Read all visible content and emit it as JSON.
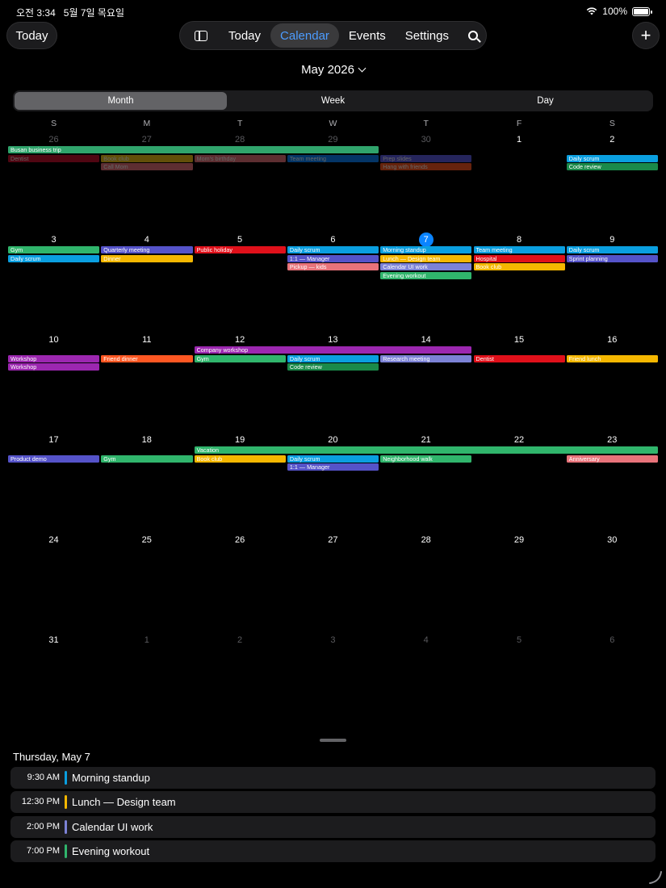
{
  "status_bar": {
    "time": "오전 3:34",
    "date": "5월 7일 목요일",
    "battery": "100%"
  },
  "toolbar": {
    "today_button": "Today",
    "nav": [
      "Today",
      "Calendar",
      "Events",
      "Settings"
    ],
    "active_nav": "Calendar"
  },
  "month_title": "May 2026",
  "view_segments": [
    "Month",
    "Week",
    "Day"
  ],
  "active_segment": "Month",
  "weekday_headers": [
    "S",
    "M",
    "T",
    "W",
    "T",
    "F",
    "S"
  ],
  "weeks": [
    {
      "days": [
        {
          "n": "26",
          "dim": true
        },
        {
          "n": "27",
          "dim": true
        },
        {
          "n": "28",
          "dim": true
        },
        {
          "n": "29",
          "dim": true
        },
        {
          "n": "30",
          "dim": true
        },
        {
          "n": "1"
        },
        {
          "n": "2"
        }
      ],
      "events": [
        {
          "title": "Busan business trip",
          "start": 0,
          "span": 4,
          "lane": 0,
          "color": "#30a46c"
        },
        {
          "title": "Dentist",
          "start": 0,
          "span": 1,
          "lane": 1,
          "color": "#c8102e",
          "dim": true
        },
        {
          "title": "Book club",
          "start": 1,
          "span": 1,
          "lane": 1,
          "color": "#f5c518",
          "dim": true
        },
        {
          "title": "Call Mom",
          "start": 1,
          "span": 1,
          "lane": 2,
          "color": "#e8737a",
          "dim": true
        },
        {
          "title": "Mom's birthday",
          "start": 2,
          "span": 1,
          "lane": 1,
          "color": "#e8737a",
          "dim": true
        },
        {
          "title": "Team meeting",
          "start": 3,
          "span": 1,
          "lane": 1,
          "color": "#0a84ff",
          "dim": true
        },
        {
          "title": "Prep slides",
          "start": 4,
          "span": 1,
          "lane": 1,
          "color": "#5e5ce6",
          "dim": true
        },
        {
          "title": "Hang with friends",
          "start": 4,
          "span": 1,
          "lane": 2,
          "color": "#ff5722",
          "dim": true
        },
        {
          "title": "Daily scrum",
          "start": 6,
          "span": 1,
          "lane": 1,
          "color": "#0a9fe0"
        },
        {
          "title": "Code review",
          "start": 6,
          "span": 1,
          "lane": 2,
          "color": "#1a8a4a"
        }
      ]
    },
    {
      "days": [
        {
          "n": "3"
        },
        {
          "n": "4"
        },
        {
          "n": "5"
        },
        {
          "n": "6"
        },
        {
          "n": "7",
          "today": true
        },
        {
          "n": "8"
        },
        {
          "n": "9"
        }
      ],
      "events": [
        {
          "title": "Gym",
          "start": 0,
          "span": 1,
          "lane": 0,
          "color": "#30b56c"
        },
        {
          "title": "Daily scrum",
          "start": 0,
          "span": 1,
          "lane": 1,
          "color": "#0a9fe0"
        },
        {
          "title": "Quarterly meeting",
          "start": 1,
          "span": 1,
          "lane": 0,
          "color": "#5553c9"
        },
        {
          "title": "Dinner",
          "start": 1,
          "span": 1,
          "lane": 1,
          "color": "#f5b700"
        },
        {
          "title": "Public holiday",
          "start": 2,
          "span": 1,
          "lane": 0,
          "color": "#e0101a"
        },
        {
          "title": "Daily scrum",
          "start": 3,
          "span": 1,
          "lane": 0,
          "color": "#0a9fe0"
        },
        {
          "title": "1:1 — Manager",
          "start": 3,
          "span": 1,
          "lane": 1,
          "color": "#5553c9"
        },
        {
          "title": "Pickup — kids",
          "start": 3,
          "span": 1,
          "lane": 2,
          "color": "#e8737a"
        },
        {
          "title": "Morning standup",
          "start": 4,
          "span": 1,
          "lane": 0,
          "color": "#0a9fe0"
        },
        {
          "title": "Lunch — Design team",
          "start": 4,
          "span": 1,
          "lane": 1,
          "color": "#f5b700"
        },
        {
          "title": "Calendar UI work",
          "start": 4,
          "span": 1,
          "lane": 2,
          "color": "#7c82d6"
        },
        {
          "title": "Evening workout",
          "start": 4,
          "span": 1,
          "lane": 3,
          "color": "#30b56c"
        },
        {
          "title": "Team meeting",
          "start": 5,
          "span": 1,
          "lane": 0,
          "color": "#0a9fe0"
        },
        {
          "title": "Hospital",
          "start": 5,
          "span": 1,
          "lane": 1,
          "color": "#e0101a"
        },
        {
          "title": "Book club",
          "start": 5,
          "span": 1,
          "lane": 2,
          "color": "#f5b700"
        },
        {
          "title": "Daily scrum",
          "start": 6,
          "span": 1,
          "lane": 0,
          "color": "#0a9fe0"
        },
        {
          "title": "Sprint planning",
          "start": 6,
          "span": 1,
          "lane": 1,
          "color": "#5553c9"
        }
      ]
    },
    {
      "days": [
        {
          "n": "10"
        },
        {
          "n": "11"
        },
        {
          "n": "12"
        },
        {
          "n": "13"
        },
        {
          "n": "14"
        },
        {
          "n": "15"
        },
        {
          "n": "16"
        }
      ],
      "events": [
        {
          "title": "Company workshop",
          "start": 2,
          "span": 3,
          "lane": 0,
          "color": "#9c27b0"
        },
        {
          "title": "Workshop",
          "start": 0,
          "span": 1,
          "lane": 1,
          "color": "#9c27b0"
        },
        {
          "title": "Workshop",
          "start": 0,
          "span": 1,
          "lane": 2,
          "color": "#9c27b0"
        },
        {
          "title": "Friend dinner",
          "start": 1,
          "span": 1,
          "lane": 1,
          "color": "#ff5722"
        },
        {
          "title": "Gym",
          "start": 2,
          "span": 1,
          "lane": 1,
          "color": "#30b56c"
        },
        {
          "title": "Daily scrum",
          "start": 3,
          "span": 1,
          "lane": 1,
          "color": "#0a9fe0"
        },
        {
          "title": "Code review",
          "start": 3,
          "span": 1,
          "lane": 2,
          "color": "#1a8a4a"
        },
        {
          "title": "Research meeting",
          "start": 4,
          "span": 1,
          "lane": 1,
          "color": "#7c82d6"
        },
        {
          "title": "Dentist",
          "start": 5,
          "span": 1,
          "lane": 1,
          "color": "#e0101a"
        },
        {
          "title": "Friend lunch",
          "start": 6,
          "span": 1,
          "lane": 1,
          "color": "#f5b700"
        }
      ]
    },
    {
      "days": [
        {
          "n": "17"
        },
        {
          "n": "18"
        },
        {
          "n": "19"
        },
        {
          "n": "20"
        },
        {
          "n": "21"
        },
        {
          "n": "22"
        },
        {
          "n": "23"
        }
      ],
      "events": [
        {
          "title": "Vacation",
          "start": 2,
          "span": 5,
          "lane": 0,
          "color": "#30b56c"
        },
        {
          "title": "Product demo",
          "start": 0,
          "span": 1,
          "lane": 1,
          "color": "#5553c9"
        },
        {
          "title": "Gym",
          "start": 1,
          "span": 1,
          "lane": 1,
          "color": "#30b56c"
        },
        {
          "title": "Book club",
          "start": 2,
          "span": 1,
          "lane": 1,
          "color": "#f5b700"
        },
        {
          "title": "Daily scrum",
          "start": 3,
          "span": 1,
          "lane": 1,
          "color": "#0a9fe0"
        },
        {
          "title": "1:1 — Manager",
          "start": 3,
          "span": 1,
          "lane": 2,
          "color": "#5553c9"
        },
        {
          "title": "Neighborhood walk",
          "start": 4,
          "span": 1,
          "lane": 1,
          "color": "#30b56c"
        },
        {
          "title": "Anniversary",
          "start": 6,
          "span": 1,
          "lane": 1,
          "color": "#e8737a"
        }
      ]
    },
    {
      "days": [
        {
          "n": "24"
        },
        {
          "n": "25"
        },
        {
          "n": "26"
        },
        {
          "n": "27"
        },
        {
          "n": "28"
        },
        {
          "n": "29"
        },
        {
          "n": "30"
        }
      ],
      "events": []
    },
    {
      "days": [
        {
          "n": "31"
        },
        {
          "n": "1",
          "dim": true
        },
        {
          "n": "2",
          "dim": true
        },
        {
          "n": "3",
          "dim": true
        },
        {
          "n": "4",
          "dim": true
        },
        {
          "n": "5",
          "dim": true
        },
        {
          "n": "6",
          "dim": true
        }
      ],
      "events": []
    }
  ],
  "agenda": {
    "title": "Thursday, May 7",
    "items": [
      {
        "time": "9:30 AM",
        "title": "Morning standup",
        "color": "#0a9fe0"
      },
      {
        "time": "12:30 PM",
        "title": "Lunch — Design team",
        "color": "#f5b700"
      },
      {
        "time": "2:00 PM",
        "title": "Calendar UI work",
        "color": "#7c82d6"
      },
      {
        "time": "7:00 PM",
        "title": "Evening workout",
        "color": "#30b56c"
      }
    ]
  }
}
